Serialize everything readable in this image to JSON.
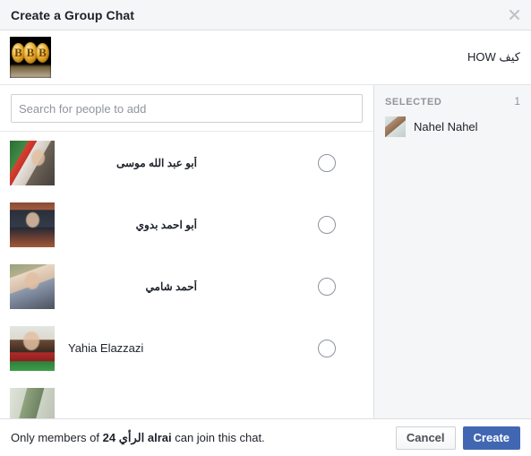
{
  "dialog": {
    "title": "Create a Group Chat",
    "close_icon": "close-icon"
  },
  "group": {
    "name": "كيف HOW",
    "avatar_alt": "three-gold-bitcoin-coins"
  },
  "search": {
    "placeholder": "Search for people to add",
    "value": ""
  },
  "people": [
    {
      "name": "أبو عبد الله موسى",
      "rtl": true,
      "selected": false,
      "avatar_alt": "man-with-palestinian-flag"
    },
    {
      "name": "أبو احمد بدوي",
      "rtl": true,
      "selected": false,
      "avatar_alt": "man-in-dark-jacket-brick-arch"
    },
    {
      "name": "أحمد شامي",
      "rtl": true,
      "selected": false,
      "avatar_alt": "man-outdoors-grey-sweater"
    },
    {
      "name": "Yahia Elazzazi",
      "rtl": false,
      "selected": false,
      "avatar_alt": "bearded-man-red-scarf"
    },
    {
      "name": "",
      "rtl": false,
      "selected": false,
      "avatar_alt": "partially-visible-photo"
    }
  ],
  "selected_panel": {
    "label": "SELECTED",
    "count": "1",
    "items": [
      {
        "name": "Nahel Nahel",
        "avatar_alt": "horse-head-photo"
      }
    ]
  },
  "footer": {
    "note_prefix": "Only members of ",
    "note_number": "24",
    "note_arabic": "الرأي",
    "note_latin": "alrai",
    "note_suffix": " can join this chat.",
    "cancel_label": "Cancel",
    "create_label": "Create"
  },
  "colors": {
    "accent_blue": "#4267b2",
    "panel_grey": "#f5f6f7",
    "border_grey": "#dddfe2",
    "muted_text": "#90949c",
    "text": "#1d2129"
  }
}
